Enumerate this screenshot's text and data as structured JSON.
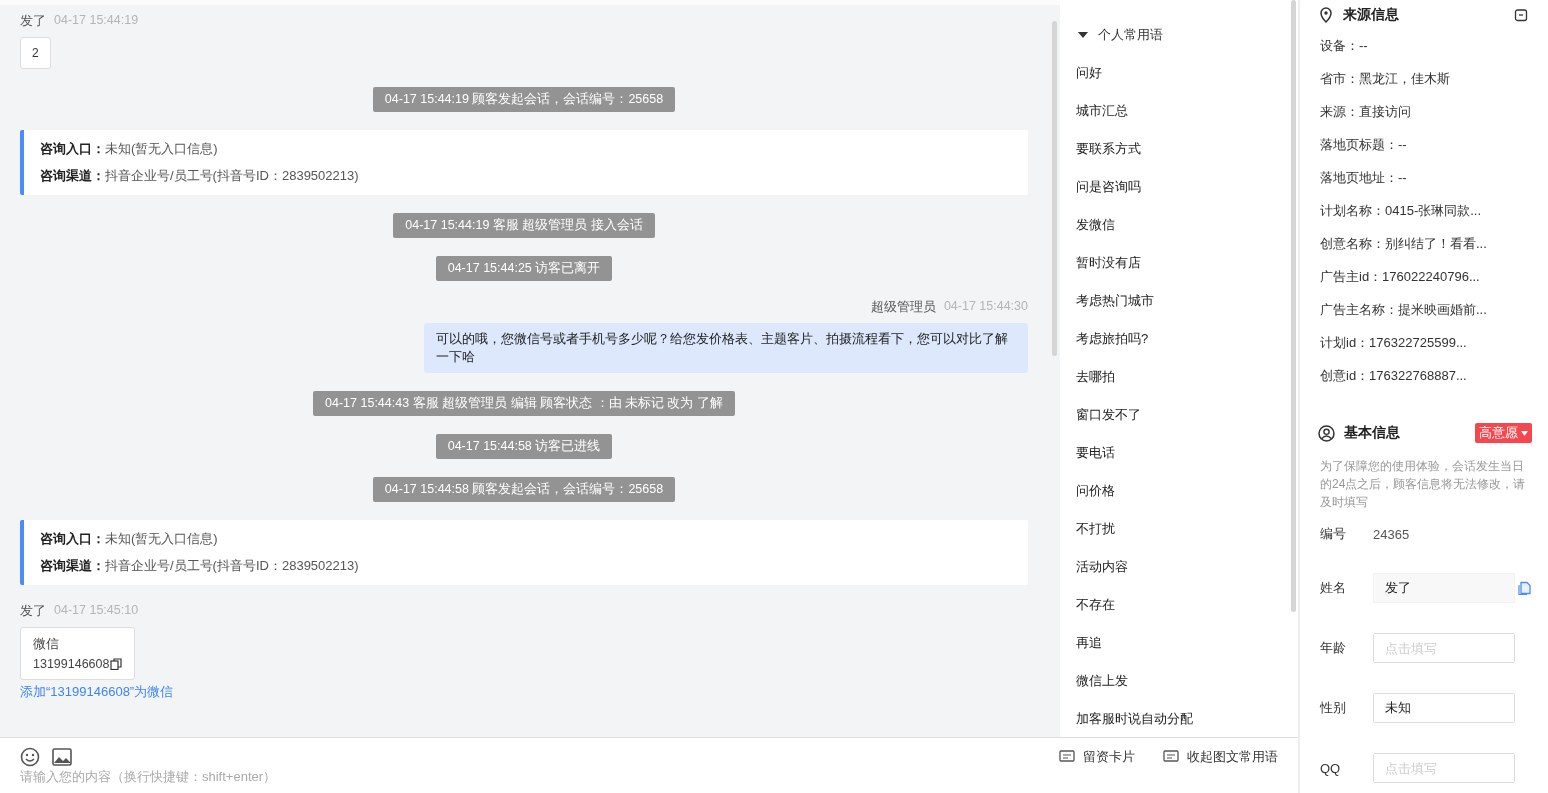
{
  "chat": {
    "messages": [
      {
        "kind": "customer",
        "sender": "发了",
        "time": "04-17 15:44:19",
        "text": "2"
      },
      {
        "kind": "system",
        "text": "04-17 15:44:19 顾客发起会话，会话编号：25658"
      },
      {
        "kind": "info",
        "lines": [
          {
            "label": "咨询入口：",
            "value": "未知(暂无入口信息)"
          },
          {
            "label": "咨询渠道：",
            "value": "抖音企业号/员工号(抖音号ID：2839502213)"
          }
        ]
      },
      {
        "kind": "system",
        "text": "04-17 15:44:19 客服 超级管理员 接入会话"
      },
      {
        "kind": "system",
        "text": "04-17 15:44:25 访客已离开"
      },
      {
        "kind": "agent",
        "sender": "超级管理员",
        "time": "04-17 15:44:30",
        "text": "可以的哦，您微信号或者手机号多少呢？给您发价格表、主题客片、拍摄流程看下，您可以对比了解一下哈"
      },
      {
        "kind": "system",
        "text": "04-17 15:44:43 客服 超级管理员 编辑 顾客状态 ：由 未标记 改为 了解"
      },
      {
        "kind": "system",
        "text": "04-17 15:44:58 访客已进线"
      },
      {
        "kind": "system",
        "text": "04-17 15:44:58 顾客发起会话，会话编号：25658"
      },
      {
        "kind": "info",
        "lines": [
          {
            "label": "咨询入口：",
            "value": "未知(暂无入口信息)"
          },
          {
            "label": "咨询渠道：",
            "value": "抖音企业号/员工号(抖音号ID：2839502213)"
          }
        ]
      },
      {
        "kind": "contact",
        "sender": "发了",
        "time": "04-17 15:45:10",
        "title": "微信",
        "number": "13199146608",
        "link": "添加“13199146608”为微信"
      }
    ]
  },
  "composer": {
    "placeholder": "请输入您的内容（换行快捷键：shift+enter）",
    "actions": [
      "留资卡片",
      "收起图文常用语"
    ]
  },
  "phrases": {
    "group": "个人常用语",
    "expanded": true,
    "items": [
      "问好",
      "城市汇总",
      "要联系方式",
      "问是咨询吗",
      "发微信",
      "暂时没有店",
      "考虑热门城市",
      "考虑旅拍吗?",
      "去哪拍",
      "窗口发不了",
      "要电话",
      "问价格",
      "不打扰",
      "活动内容",
      "不存在",
      "再追",
      "微信上发",
      "加客服时说自动分配"
    ]
  },
  "source_info": {
    "title": "来源信息",
    "fields": [
      "设备：--",
      "省市：黑龙江，佳木斯",
      "来源：直接访问",
      "落地页标题：--",
      "落地页地址：--",
      "计划名称：0415-张琳同款...",
      "创意名称：别纠结了！看看...",
      "广告主id：176022240796...",
      "广告主名称：提米映画婚前...",
      "计划id：176322725599...",
      "创意id：176322768887..."
    ]
  },
  "basic_info": {
    "title": "基本信息",
    "tag": "高意愿",
    "notice": "为了保障您的使用体验，会话发生当日的24点之后，顾客信息将无法修改，请及时填写",
    "number_label": "编号",
    "number": "24365",
    "fields": [
      {
        "label": "姓名",
        "kind": "readonly",
        "value": "发了"
      },
      {
        "label": "年龄",
        "kind": "input",
        "placeholder": "点击填写"
      },
      {
        "label": "性别",
        "kind": "input",
        "value": "未知"
      },
      {
        "label": "QQ",
        "kind": "input",
        "placeholder": "点击填写"
      }
    ]
  }
}
